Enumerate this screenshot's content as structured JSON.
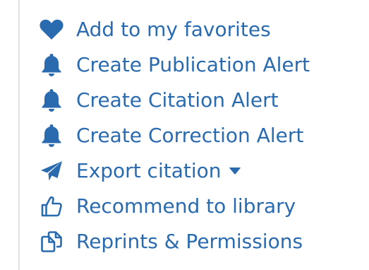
{
  "colors": {
    "link": "#2a6bb0",
    "rule": "#e2e2e2"
  },
  "actions": [
    {
      "label": "Add to my favorites",
      "icon": "heart-icon"
    },
    {
      "label": "Create Publication Alert",
      "icon": "bell-icon"
    },
    {
      "label": "Create Citation Alert",
      "icon": "bell-icon"
    },
    {
      "label": "Create Correction Alert",
      "icon": "bell-icon"
    },
    {
      "label": "Export citation",
      "icon": "paper-plane-icon",
      "dropdown_icon": "caret-down-icon"
    },
    {
      "label": "Recommend to library",
      "icon": "thumbs-up-icon"
    },
    {
      "label": "Reprints & Permissions",
      "icon": "copy-icon"
    }
  ]
}
